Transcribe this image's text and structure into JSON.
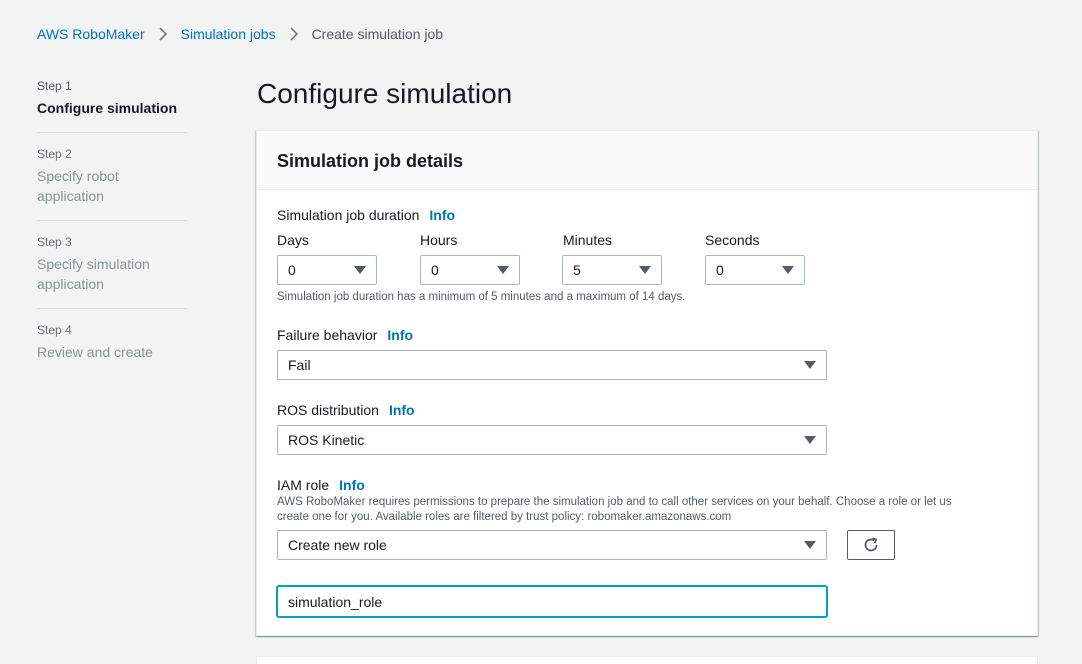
{
  "breadcrumb": {
    "items": [
      "AWS RoboMaker",
      "Simulation jobs",
      "Create simulation job"
    ]
  },
  "steps": [
    {
      "num": "Step 1",
      "title": "Configure simulation"
    },
    {
      "num": "Step 2",
      "title": "Specify robot application"
    },
    {
      "num": "Step 3",
      "title": "Specify simulation application"
    },
    {
      "num": "Step 4",
      "title": "Review and create"
    }
  ],
  "page_title": "Configure simulation",
  "panel": {
    "title": "Simulation job details",
    "duration": {
      "label": "Simulation job duration",
      "info": "Info",
      "days_label": "Days",
      "days_value": "0",
      "hours_label": "Hours",
      "hours_value": "0",
      "minutes_label": "Minutes",
      "minutes_value": "5",
      "seconds_label": "Seconds",
      "seconds_value": "0",
      "hint": "Simulation job duration has a minimum of 5 minutes and a maximum of 14 days."
    },
    "failure": {
      "label": "Failure behavior",
      "info": "Info",
      "value": "Fail"
    },
    "ros": {
      "label": "ROS distribution",
      "info": "Info",
      "value": "ROS Kinetic"
    },
    "iam": {
      "label": "IAM role",
      "info": "Info",
      "hint_line1": "AWS RoboMaker requires permissions to prepare the simulation job and to call other services on your behalf. Choose a role or let us",
      "hint_line2": "create one for you. Available roles are filtered by trust policy: robomaker.amazonaws.com",
      "value": "Create new role",
      "role_name": "simulation_role"
    }
  },
  "icons": {
    "breadcrumb_separator": "chevron-right-icon",
    "select_caret": "caret-down-icon",
    "refresh": "refresh-icon"
  },
  "colors": {
    "link": "#0073bb",
    "background": "#f2f3f3",
    "focus": "#00a1c9"
  }
}
